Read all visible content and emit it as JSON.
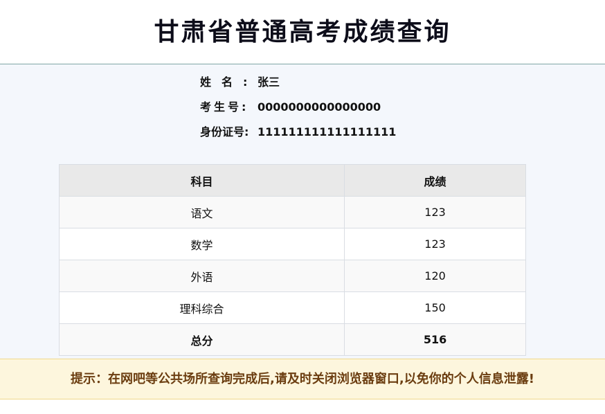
{
  "header": {
    "title": "甘肃省普通高考成绩查询"
  },
  "student": {
    "name_label": "姓名:",
    "name_value": "张三",
    "exam_no_label": "考生号:",
    "exam_no_value": "0000000000000000",
    "id_label": "身份证号:",
    "id_value": "111111111111111111"
  },
  "table": {
    "headers": [
      "科目",
      "成绩"
    ],
    "rows": [
      {
        "subject": "语文",
        "score": "123"
      },
      {
        "subject": "数学",
        "score": "123"
      },
      {
        "subject": "外语",
        "score": "120"
      },
      {
        "subject": "理科综合",
        "score": "150"
      }
    ],
    "total": {
      "subject": "总分",
      "score": "516"
    }
  },
  "notice": {
    "text": "提示：在网吧等公共场所查询完成后,请及时关闭浏览器窗口,以免你的个人信息泄露!"
  },
  "colors": {
    "notice_bg": "#fdf6dd",
    "notice_text": "#6b3d10",
    "main_bg": "#f4f7fc",
    "table_header_bg": "#e9e9e9"
  }
}
